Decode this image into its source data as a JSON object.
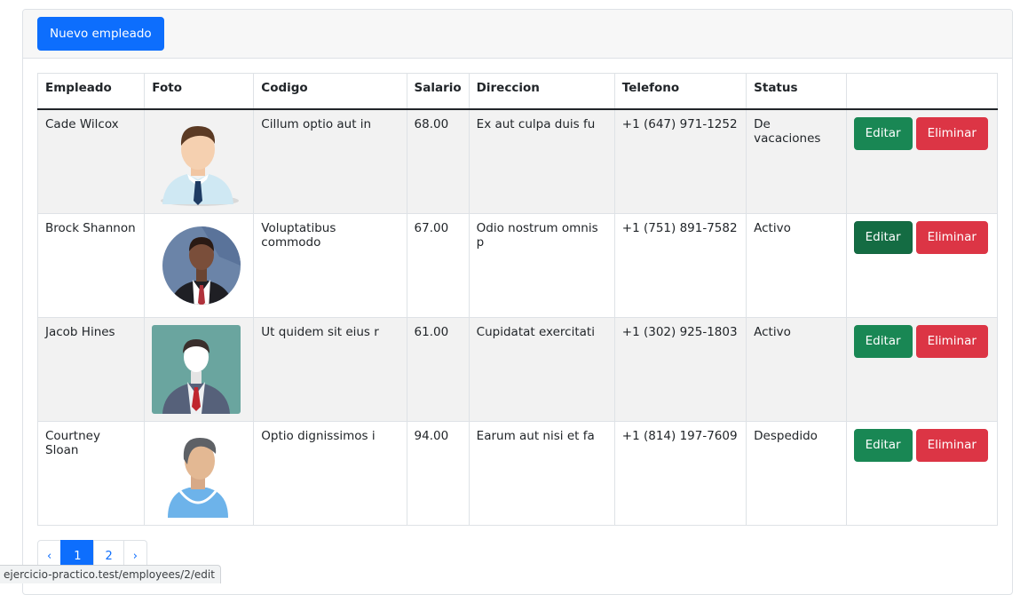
{
  "header": {
    "new_employee_label": "Nuevo empleado"
  },
  "table": {
    "columns": [
      "Empleado",
      "Foto",
      "Codigo",
      "Salario",
      "Direccion",
      "Telefono",
      "Status",
      ""
    ],
    "rows": [
      {
        "name": "Cade Wilcox",
        "code": "Cillum optio aut in",
        "salary": "68.00",
        "address": "Ex aut culpa duis fu",
        "phone": "+1 (647) 971-1252",
        "status": "De vacaciones",
        "edit": "Editar",
        "delete": "Eliminar"
      },
      {
        "name": "Brock Shannon",
        "code": "Voluptatibus commodo",
        "salary": "67.00",
        "address": "Odio nostrum omnis p",
        "phone": "+1 (751) 891-7582",
        "status": "Activo",
        "edit": "Editar",
        "delete": "Eliminar"
      },
      {
        "name": "Jacob Hines",
        "code": "Ut quidem sit eius r",
        "salary": "61.00",
        "address": "Cupidatat exercitati",
        "phone": "+1 (302) 925-1803",
        "status": "Activo",
        "edit": "Editar",
        "delete": "Eliminar"
      },
      {
        "name": "Courtney Sloan",
        "code": "Optio dignissimos i",
        "salary": "94.00",
        "address": "Earum aut nisi et fa",
        "phone": "+1 (814) 197-7609",
        "status": "Despedido",
        "edit": "Editar",
        "delete": "Eliminar"
      }
    ]
  },
  "pagination": {
    "prev": "‹",
    "pages": [
      "1",
      "2"
    ],
    "next": "›",
    "current": "1"
  },
  "status_bar": {
    "url": "ejercicio-practico.test/employees/2/edit"
  },
  "colors": {
    "primary": "#0d6efd",
    "success": "#198754",
    "danger": "#dc3545"
  }
}
